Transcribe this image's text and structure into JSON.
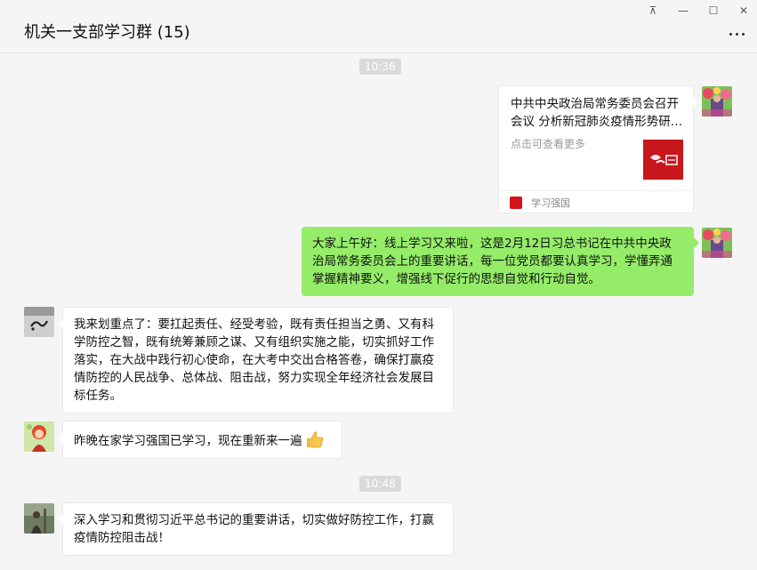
{
  "window": {
    "title": "机关一支部学习群 (15)",
    "controls": {
      "pin": "⊼",
      "minimize": "—",
      "maximize": "☐",
      "close": "✕"
    }
  },
  "timestamps": [
    "10:36",
    "10:48"
  ],
  "card": {
    "title": "中共中央政治局常务委员会召开会议 分析新冠肺炎疫情形势研…",
    "desc": "点击可查看更多",
    "source": "学习强国",
    "icon": "xuexi-qiangguo-logo"
  },
  "messages": [
    {
      "side": "right",
      "text": "大家上午好：线上学习又来啦，这是2月12日习总书记在中共中央政治局常务委员会上的重要讲话，每一位党员都要认真学习，学懂弄通掌握精神要义，增强线下促行的思想自觉和行动自觉。"
    },
    {
      "side": "left",
      "text": "我来划重点了：要扛起责任、经受考验，既有责任担当之勇、又有科学防控之智，既有统筹兼顾之谋、又有组织实施之能，切实抓好工作落实，在大战中践行初心使命，在大考中交出合格答卷，确保打赢疫情防控的人民战争、总体战、阻击战，努力实现全年经济社会发展目标任务。"
    },
    {
      "side": "left",
      "text": "昨晚在家学习强国已学习，现在重新来一遍",
      "emoji": "thumbs-up-icon"
    },
    {
      "side": "left",
      "text": "深入学习和贯彻习近平总书记的重要讲话，切实做好防控工作，打赢疫情防控阻击战！"
    }
  ],
  "colors": {
    "background": "#f5f5f5",
    "self_bubble": "#95ec69",
    "other_bubble": "#ffffff",
    "timestamp_bg": "#dadada",
    "brand_red": "#c8161d"
  }
}
